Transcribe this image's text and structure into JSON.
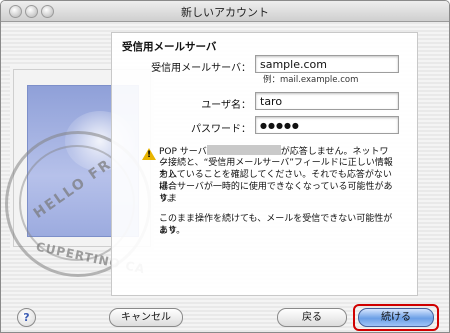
{
  "window": {
    "title": "新しいアカウント"
  },
  "section": {
    "title": "受信用メールサーバ"
  },
  "form": {
    "incoming_server_label": "受信用メールサーバ：",
    "incoming_server_value": "sample.com",
    "incoming_server_hint": "例：mail.example.com",
    "username_label": "ユーザ名：",
    "username_value": "taro",
    "password_label": "パスワード：",
    "password_value": "●●●●●"
  },
  "warning": {
    "line1_prefix": "POP サーバ",
    "line1_suffix": "が応答しません。ネットワー",
    "line2": "ク接続と、“受信用メールサーバ”フィールドに正しい情報を入",
    "line3": "力していることを確認してください。それでも応答がない場合",
    "line4": "は、サーバが一時的に使用できなくなっている可能性がありま",
    "line5": "す。",
    "line6": "このまま操作を続けても、メールを受信できない可能性があり",
    "line7": "ます。"
  },
  "stamp": {
    "text_top": "HELLO FR",
    "text_bottom": "CUPERTINO CA"
  },
  "buttons": {
    "help": "?",
    "cancel": "キャンセル",
    "back": "戻る",
    "continue": "続ける"
  }
}
